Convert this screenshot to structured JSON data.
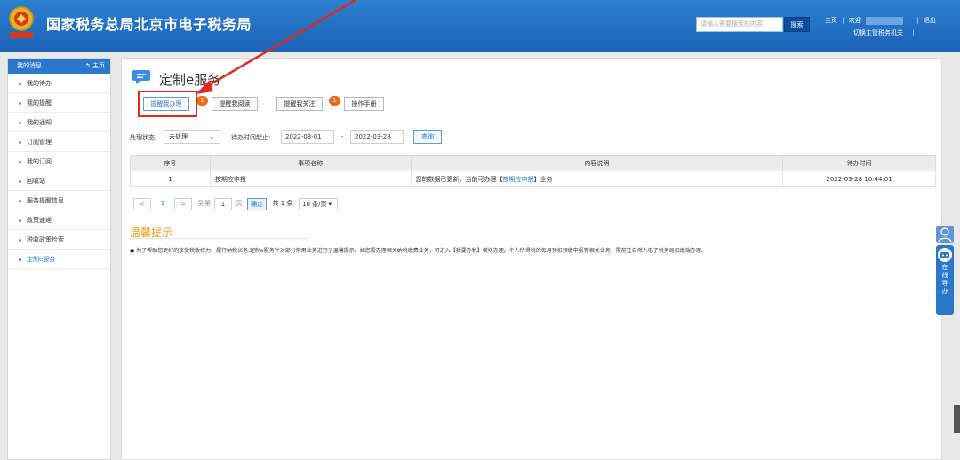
{
  "header": {
    "site_title": "国家税务总局北京市电子税务局",
    "search_placeholder": "请输入需要搜索的内容",
    "search_button": "搜索",
    "home_link": "主页",
    "separator": "|",
    "welcome_label": "欢迎",
    "logout_link": "退出",
    "switch_authority_link": "切换主管税务机关",
    "accent_color": "#1b63b6"
  },
  "sidebar": {
    "title": "我的消息",
    "home_label": "主页",
    "items": [
      {
        "label": "我的待办"
      },
      {
        "label": "我的提醒"
      },
      {
        "label": "我的通知"
      },
      {
        "label": "订阅管理"
      },
      {
        "label": "我的订阅"
      },
      {
        "label": "回收站"
      },
      {
        "label": "服务提醒信息"
      },
      {
        "label": "政策速递"
      },
      {
        "label": "税收政策检索"
      },
      {
        "label": "定制e服务"
      }
    ],
    "active_item": "定制e服务"
  },
  "main": {
    "page_title": "定制e服务",
    "tabs": [
      {
        "label": "提醒我办理",
        "badge": "1"
      },
      {
        "label": "提醒我阅读"
      },
      {
        "label": "提醒我关注",
        "badge": "1"
      },
      {
        "label": "操作手册"
      }
    ],
    "filters": {
      "status_label": "处理状态:",
      "status_value": "未处理",
      "date_label": "待办时间起止:",
      "date_start": "2022-03-01",
      "date_dash": "-",
      "date_end": "2022-03-28",
      "query_button": "查询"
    },
    "table": {
      "headers": [
        "序号",
        "事项名称",
        "内容说明",
        "待办时间"
      ],
      "rows": [
        {
          "index": "1",
          "name": "按期应申报",
          "desc_prefix": "您的数据已更新，当前可办理【",
          "desc_link": "按期应申报",
          "desc_suffix": "】业务",
          "time": "2022-03-28 10:44:01"
        }
      ]
    },
    "pager": {
      "prev": "<",
      "page": "1",
      "next": ">",
      "goto_label": "到第",
      "goto_value": "1",
      "page_unit": "页",
      "confirm": "确定",
      "total": "共 1 条",
      "page_size": "10 条/页"
    },
    "tips": {
      "title": "温馨提示",
      "text": "● 为了帮助您更好的享受税收权力、履行纳税义务,定制e服务针对部分常用业务进行了温馨提示。如您需办理相关纳税缴费业务，可进入【我要办税】模块办理。个人所得税的每月预扣预缴申报等相关业务，需前往自然人电子税务局扣缴端办理。"
    }
  },
  "float_panel": {
    "guide_chars": [
      "在",
      "线",
      "导",
      "办"
    ]
  }
}
